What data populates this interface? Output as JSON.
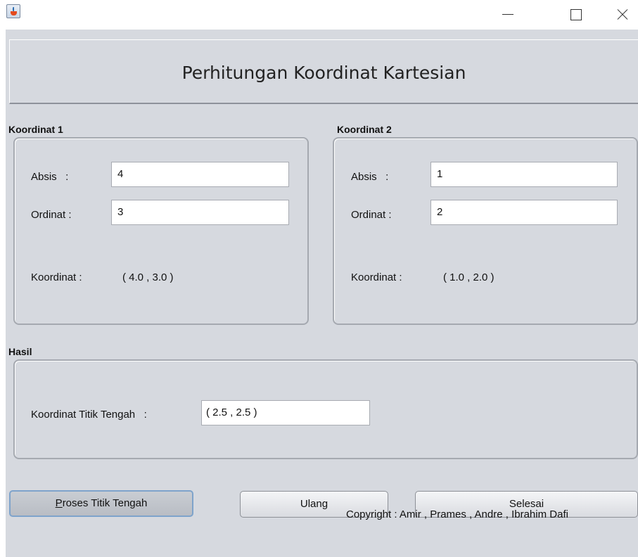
{
  "window": {
    "minimize_icon": "minimize-icon",
    "maximize_icon": "maximize-icon",
    "close_icon": "close-icon",
    "app_icon": "java-cup-icon"
  },
  "header": {
    "title": "Perhitungan Koordinat Kartesian"
  },
  "koordinat1": {
    "group_title": "Koordinat 1",
    "absis_label": "Absis   :",
    "absis_value": "4",
    "ordinat_label": "Ordinat :",
    "ordinat_value": "3",
    "koordinat_label": "Koordinat :",
    "koordinat_value": "( 4.0 , 3.0 )"
  },
  "koordinat2": {
    "group_title": "Koordinat 2",
    "absis_label": "Absis   :",
    "absis_value": "1",
    "ordinat_label": "Ordinat :",
    "ordinat_value": "2",
    "koordinat_label": "Koordinat :",
    "koordinat_value": "( 1.0 , 2.0 )"
  },
  "hasil": {
    "group_title": "Hasil",
    "titik_tengah_label": "Koordinat Titik Tengah   :",
    "titik_tengah_value": "( 2.5 , 2.5 )"
  },
  "buttons": {
    "proses_mnemonic": "P",
    "proses_rest": "roses Titik Tengah",
    "ulang": "Ulang",
    "selesai": "Selesai"
  },
  "footer": {
    "copyright": "Copyright : Amir , Prames , Andre , Ibrahim Dafi"
  },
  "colors": {
    "panel_bg": "#d6d9df",
    "focus_border": "#7ea3cb"
  }
}
